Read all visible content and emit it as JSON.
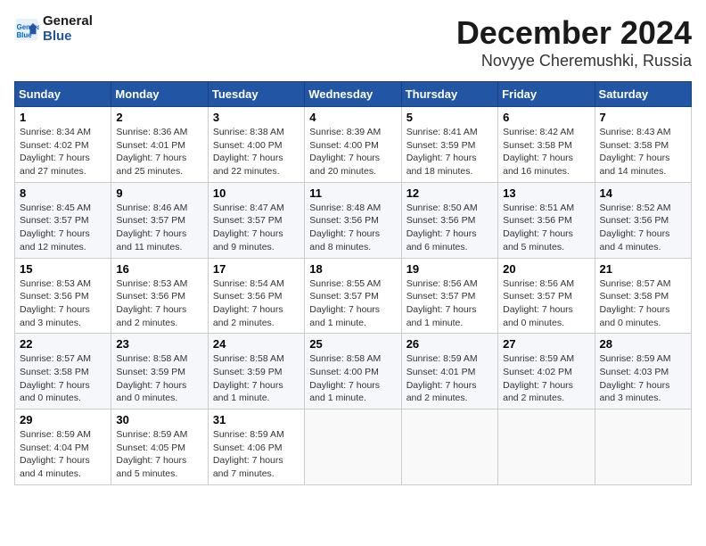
{
  "logo": {
    "line1": "General",
    "line2": "Blue"
  },
  "title": "December 2024",
  "location": "Novyye Cheremushki, Russia",
  "days_header": [
    "Sunday",
    "Monday",
    "Tuesday",
    "Wednesday",
    "Thursday",
    "Friday",
    "Saturday"
  ],
  "weeks": [
    [
      {
        "day": "1",
        "info": "Sunrise: 8:34 AM\nSunset: 4:02 PM\nDaylight: 7 hours\nand 27 minutes."
      },
      {
        "day": "2",
        "info": "Sunrise: 8:36 AM\nSunset: 4:01 PM\nDaylight: 7 hours\nand 25 minutes."
      },
      {
        "day": "3",
        "info": "Sunrise: 8:38 AM\nSunset: 4:00 PM\nDaylight: 7 hours\nand 22 minutes."
      },
      {
        "day": "4",
        "info": "Sunrise: 8:39 AM\nSunset: 4:00 PM\nDaylight: 7 hours\nand 20 minutes."
      },
      {
        "day": "5",
        "info": "Sunrise: 8:41 AM\nSunset: 3:59 PM\nDaylight: 7 hours\nand 18 minutes."
      },
      {
        "day": "6",
        "info": "Sunrise: 8:42 AM\nSunset: 3:58 PM\nDaylight: 7 hours\nand 16 minutes."
      },
      {
        "day": "7",
        "info": "Sunrise: 8:43 AM\nSunset: 3:58 PM\nDaylight: 7 hours\nand 14 minutes."
      }
    ],
    [
      {
        "day": "8",
        "info": "Sunrise: 8:45 AM\nSunset: 3:57 PM\nDaylight: 7 hours\nand 12 minutes."
      },
      {
        "day": "9",
        "info": "Sunrise: 8:46 AM\nSunset: 3:57 PM\nDaylight: 7 hours\nand 11 minutes."
      },
      {
        "day": "10",
        "info": "Sunrise: 8:47 AM\nSunset: 3:57 PM\nDaylight: 7 hours\nand 9 minutes."
      },
      {
        "day": "11",
        "info": "Sunrise: 8:48 AM\nSunset: 3:56 PM\nDaylight: 7 hours\nand 8 minutes."
      },
      {
        "day": "12",
        "info": "Sunrise: 8:50 AM\nSunset: 3:56 PM\nDaylight: 7 hours\nand 6 minutes."
      },
      {
        "day": "13",
        "info": "Sunrise: 8:51 AM\nSunset: 3:56 PM\nDaylight: 7 hours\nand 5 minutes."
      },
      {
        "day": "14",
        "info": "Sunrise: 8:52 AM\nSunset: 3:56 PM\nDaylight: 7 hours\nand 4 minutes."
      }
    ],
    [
      {
        "day": "15",
        "info": "Sunrise: 8:53 AM\nSunset: 3:56 PM\nDaylight: 7 hours\nand 3 minutes."
      },
      {
        "day": "16",
        "info": "Sunrise: 8:53 AM\nSunset: 3:56 PM\nDaylight: 7 hours\nand 2 minutes."
      },
      {
        "day": "17",
        "info": "Sunrise: 8:54 AM\nSunset: 3:56 PM\nDaylight: 7 hours\nand 2 minutes."
      },
      {
        "day": "18",
        "info": "Sunrise: 8:55 AM\nSunset: 3:57 PM\nDaylight: 7 hours\nand 1 minute."
      },
      {
        "day": "19",
        "info": "Sunrise: 8:56 AM\nSunset: 3:57 PM\nDaylight: 7 hours\nand 1 minute."
      },
      {
        "day": "20",
        "info": "Sunrise: 8:56 AM\nSunset: 3:57 PM\nDaylight: 7 hours\nand 0 minutes."
      },
      {
        "day": "21",
        "info": "Sunrise: 8:57 AM\nSunset: 3:58 PM\nDaylight: 7 hours\nand 0 minutes."
      }
    ],
    [
      {
        "day": "22",
        "info": "Sunrise: 8:57 AM\nSunset: 3:58 PM\nDaylight: 7 hours\nand 0 minutes."
      },
      {
        "day": "23",
        "info": "Sunrise: 8:58 AM\nSunset: 3:59 PM\nDaylight: 7 hours\nand 0 minutes."
      },
      {
        "day": "24",
        "info": "Sunrise: 8:58 AM\nSunset: 3:59 PM\nDaylight: 7 hours\nand 1 minute."
      },
      {
        "day": "25",
        "info": "Sunrise: 8:58 AM\nSunset: 4:00 PM\nDaylight: 7 hours\nand 1 minute."
      },
      {
        "day": "26",
        "info": "Sunrise: 8:59 AM\nSunset: 4:01 PM\nDaylight: 7 hours\nand 2 minutes."
      },
      {
        "day": "27",
        "info": "Sunrise: 8:59 AM\nSunset: 4:02 PM\nDaylight: 7 hours\nand 2 minutes."
      },
      {
        "day": "28",
        "info": "Sunrise: 8:59 AM\nSunset: 4:03 PM\nDaylight: 7 hours\nand 3 minutes."
      }
    ],
    [
      {
        "day": "29",
        "info": "Sunrise: 8:59 AM\nSunset: 4:04 PM\nDaylight: 7 hours\nand 4 minutes."
      },
      {
        "day": "30",
        "info": "Sunrise: 8:59 AM\nSunset: 4:05 PM\nDaylight: 7 hours\nand 5 minutes."
      },
      {
        "day": "31",
        "info": "Sunrise: 8:59 AM\nSunset: 4:06 PM\nDaylight: 7 hours\nand 7 minutes."
      },
      {
        "day": "",
        "info": ""
      },
      {
        "day": "",
        "info": ""
      },
      {
        "day": "",
        "info": ""
      },
      {
        "day": "",
        "info": ""
      }
    ]
  ]
}
